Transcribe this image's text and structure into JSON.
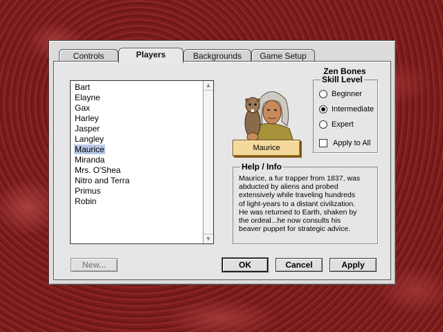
{
  "tabs": [
    {
      "label": "Controls"
    },
    {
      "label": "Players"
    },
    {
      "label": "Backgrounds"
    },
    {
      "label": "Game Setup"
    }
  ],
  "active_tab": "Players",
  "players": [
    {
      "name": "Bart"
    },
    {
      "name": "Elayne"
    },
    {
      "name": "Gax"
    },
    {
      "name": "Harley"
    },
    {
      "name": "Jasper"
    },
    {
      "name": "Langley"
    },
    {
      "name": "Maurice"
    },
    {
      "name": "Miranda"
    },
    {
      "name": "Mrs. O'Shea"
    },
    {
      "name": "Nitro and Terra"
    },
    {
      "name": "Primus"
    },
    {
      "name": "Robin"
    }
  ],
  "selected_player": "Maurice",
  "portrait": {
    "name": "Maurice",
    "icon": "maurice-portrait-icon"
  },
  "skill": {
    "game_title": "Zen Bones",
    "title": "Skill Level",
    "options": [
      {
        "label": "Beginner",
        "selected": false
      },
      {
        "label": "Intermediate",
        "selected": true
      },
      {
        "label": "Expert",
        "selected": false
      }
    ],
    "apply_all_label": "Apply to All",
    "apply_all_checked": false
  },
  "help": {
    "title": "Help / Info",
    "lines": [
      "Maurice, a fur trapper from 1837, was",
      "abducted by aliens and probed",
      "extensively while traveling hundreds",
      "of light-years to a distant civilization.",
      "He was returned to Earth, shaken by",
      "the ordeal...he now consults his",
      "beaver puppet for strategic advice."
    ]
  },
  "buttons": {
    "new_label": "New...",
    "ok_label": "OK",
    "cancel_label": "Cancel",
    "apply_label": "Apply"
  },
  "colors": {
    "background": "#7d1d1d",
    "panel": "#dcdcdc",
    "selection": "#b8c8e8",
    "nameplate": "#f4d99a"
  }
}
